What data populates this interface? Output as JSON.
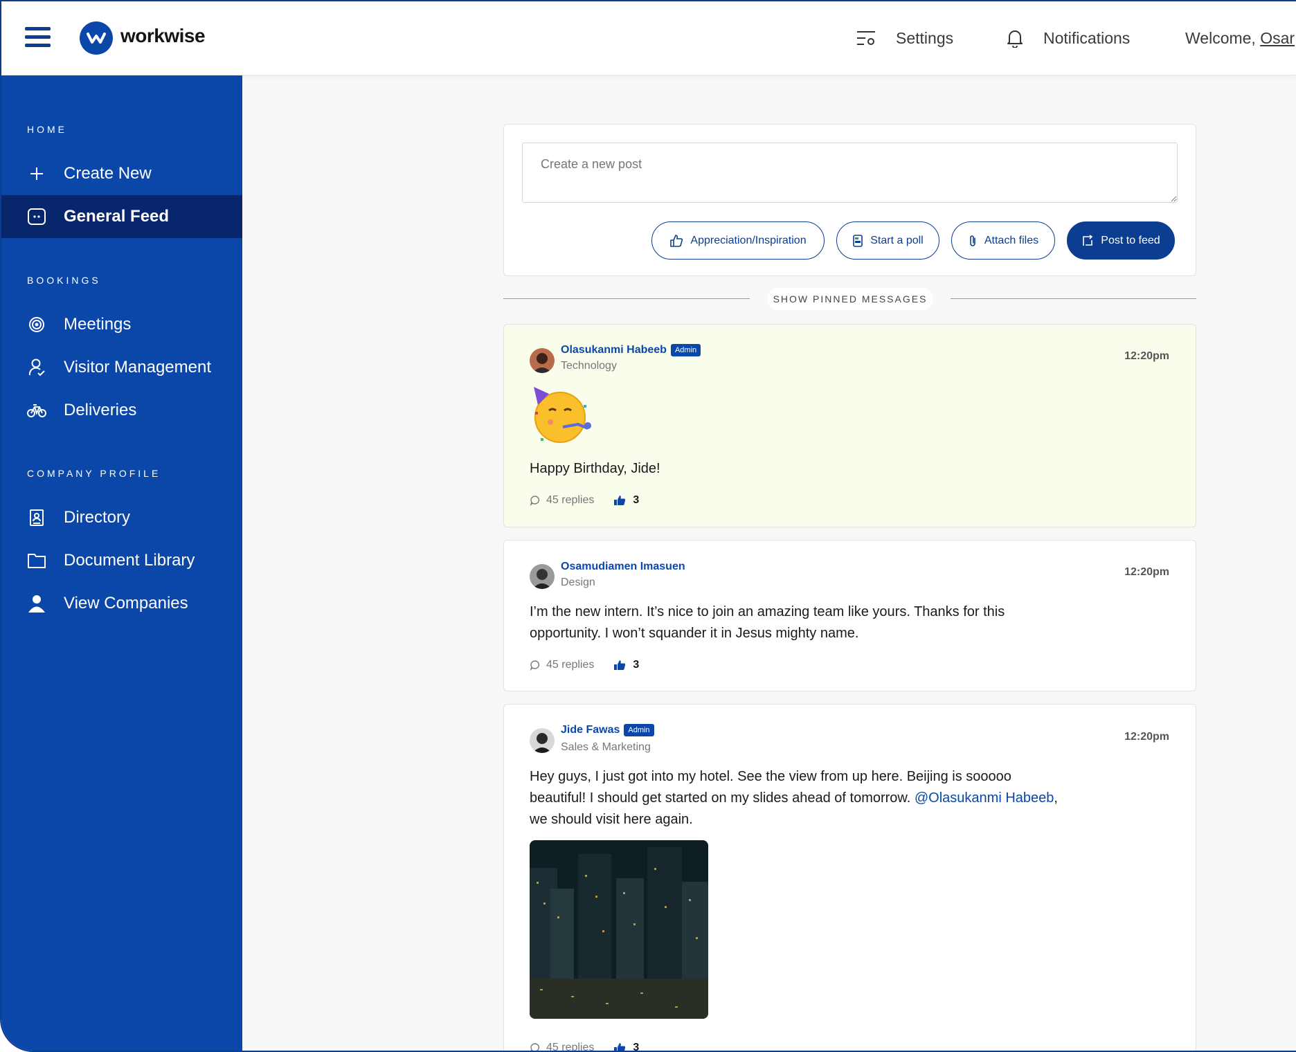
{
  "topbar": {
    "logo_text": "workwise",
    "settings_label": "Settings",
    "notifications_label": "Notifications",
    "welcome_prefix": "Welcome, ",
    "welcome_name": "Osar"
  },
  "sidebar": {
    "sections": {
      "home": "HOME",
      "bookings": "BOOKINGS",
      "company_profile": "COMPANY PROFILE"
    },
    "items": [
      {
        "label": "Create New",
        "icon": "plus-icon"
      },
      {
        "label": "General Feed",
        "icon": "feed-icon",
        "active": true
      },
      {
        "label": "Meetings",
        "icon": "target-icon"
      },
      {
        "label": "Visitor Management",
        "icon": "visitor-icon"
      },
      {
        "label": "Deliveries",
        "icon": "bicycle-icon"
      },
      {
        "label": "Directory",
        "icon": "contact-book-icon"
      },
      {
        "label": "Document Library",
        "icon": "folder-icon"
      },
      {
        "label": "View Companies",
        "icon": "person-icon"
      }
    ]
  },
  "composer": {
    "placeholder": "Create a new post",
    "appreciation_label": "Appreciation/Inspiration",
    "poll_label": "Start a poll",
    "attach_label": "Attach files",
    "post_label": "Post to feed"
  },
  "pinned": {
    "label": "SHOW PINNED MESSAGES"
  },
  "posts": [
    {
      "author": "Olasukanmi Habeeb",
      "badge": "Admin",
      "department": "Technology",
      "time": "12:20pm",
      "text": "Happy Birthday, Jide!",
      "replies": "45 replies",
      "likes": "3"
    },
    {
      "author": "Osamudiamen Imasuen",
      "department": "Design",
      "time": "12:20pm",
      "text": "I’m the new intern. It’s nice to join an amazing team like yours. Thanks for this opportunity. I won’t squander it in Jesus mighty name.",
      "replies": "45 replies",
      "likes": "3"
    },
    {
      "author": "Jide Fawas",
      "badge": "Admin",
      "department": "Sales & Marketing",
      "time": "12:20pm",
      "text_before": "Hey guys, I just got into my hotel. See the view from up here. Beijing is sooooo beautiful! I should get started on my slides ahead of tomorrow. ",
      "mention": "@Olasukanmi Habeeb",
      "text_after": ", we should visit here again.",
      "replies": "45 replies",
      "likes": "3"
    }
  ],
  "colors": {
    "brand": "#0b47a8",
    "brand_dark": "#08266b",
    "pinned_bg": "#f9fdec"
  }
}
